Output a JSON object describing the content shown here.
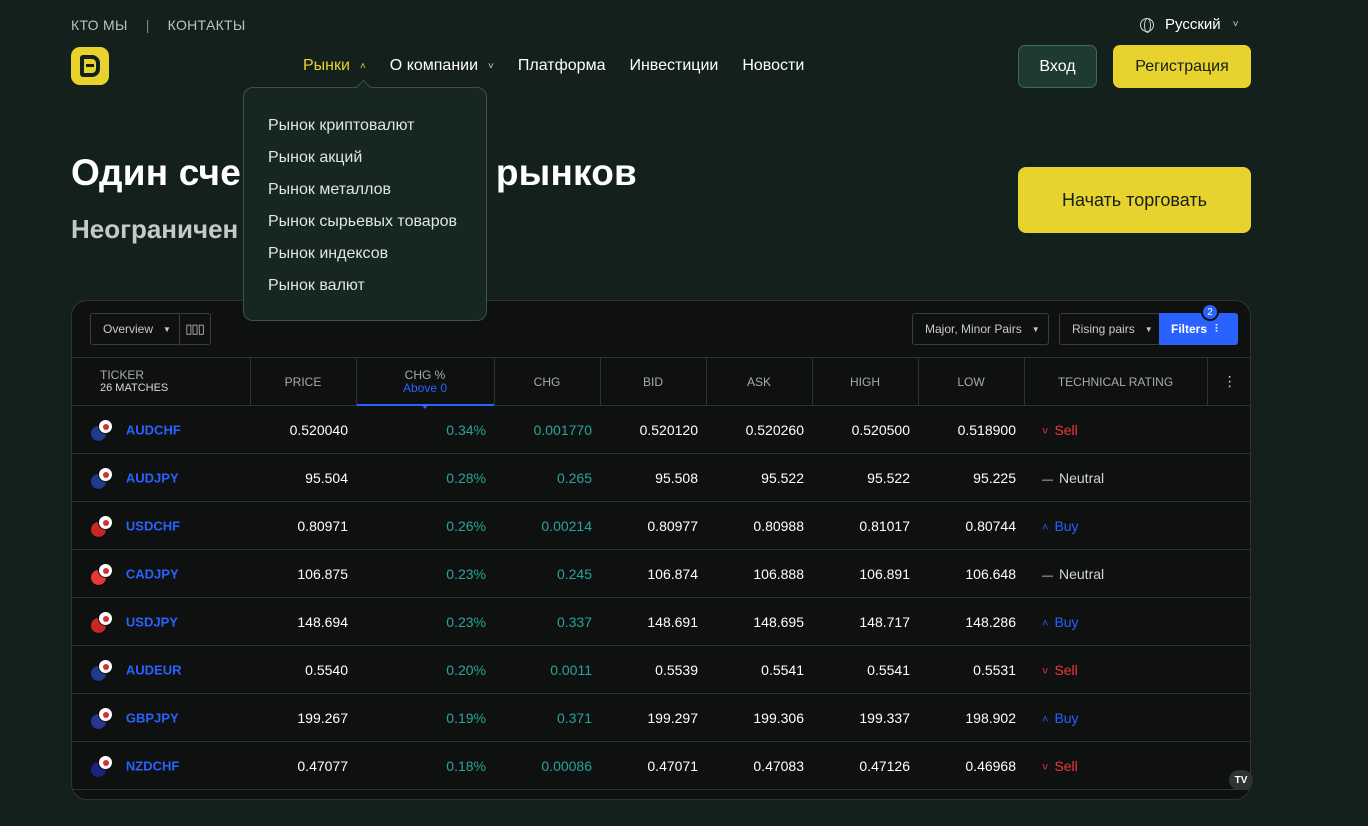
{
  "topbar": {
    "about": "КТО МЫ",
    "separator": "|",
    "contacts": "КОНТАКТЫ"
  },
  "lang": {
    "label": "Русский",
    "icon": "globe-icon"
  },
  "nav": {
    "items": [
      {
        "label": "Рынки",
        "caret": "˄",
        "active": true
      },
      {
        "label": "О компании",
        "caret": "˅"
      },
      {
        "label": "Платформа"
      },
      {
        "label": "Инвестиции"
      },
      {
        "label": "Новости"
      }
    ]
  },
  "auth": {
    "login": "Вход",
    "register": "Регистрация"
  },
  "hero": {
    "title": "Один сче                   во рынков",
    "subtitle": "Неограничен",
    "cta": "Начать торговать"
  },
  "dropdown": {
    "items": [
      "Рынок криптовалют",
      "Рынок акций",
      "Рынок металлов",
      "Рынок сырьевых товаров",
      "Рынок индексов",
      "Рынок валют"
    ]
  },
  "widget": {
    "toolbar": {
      "overview": "Overview",
      "columns_icon": "▯▯▯",
      "pairs": "Major, Minor Pairs",
      "rising": "Rising pairs",
      "filters": "Filters",
      "filters_icon": "⫶",
      "filters_count": "2"
    },
    "headers": {
      "ticker": "TICKER",
      "matches": "26 MATCHES",
      "price": "PRICE",
      "chg_pct": "CHG %",
      "chg_pct_filter": "Above 0",
      "chg": "CHG",
      "bid": "BID",
      "ask": "ASK",
      "high": "HIGH",
      "low": "LOW",
      "rating": "TECHNICAL RATING",
      "more": "⋮"
    },
    "rows": [
      {
        "sym": "AUDCHF",
        "flag1": "#1e3a8a",
        "price": "0.520040",
        "chgp": "0.34%",
        "chg": "0.001770",
        "bid": "0.520120",
        "ask": "0.520260",
        "high": "0.520500",
        "low": "0.518900",
        "rating": "Sell",
        "ricon": "˅"
      },
      {
        "sym": "AUDJPY",
        "flag1": "#1e3a8a",
        "price": "95.504",
        "chgp": "0.28%",
        "chg": "0.265",
        "bid": "95.508",
        "ask": "95.522",
        "high": "95.522",
        "low": "95.225",
        "rating": "Neutral",
        "ricon": "—"
      },
      {
        "sym": "USDCHF",
        "flag1": "#c62828",
        "price": "0.80971",
        "chgp": "0.26%",
        "chg": "0.00214",
        "bid": "0.80977",
        "ask": "0.80988",
        "high": "0.81017",
        "low": "0.80744",
        "rating": "Buy",
        "ricon": "˄"
      },
      {
        "sym": "CADJPY",
        "flag1": "#e53935",
        "price": "106.875",
        "chgp": "0.23%",
        "chg": "0.245",
        "bid": "106.874",
        "ask": "106.888",
        "high": "106.891",
        "low": "106.648",
        "rating": "Neutral",
        "ricon": "—"
      },
      {
        "sym": "USDJPY",
        "flag1": "#c62828",
        "price": "148.694",
        "chgp": "0.23%",
        "chg": "0.337",
        "bid": "148.691",
        "ask": "148.695",
        "high": "148.717",
        "low": "148.286",
        "rating": "Buy",
        "ricon": "˄"
      },
      {
        "sym": "AUDEUR",
        "flag1": "#1e3a8a",
        "price": "0.5540",
        "chgp": "0.20%",
        "chg": "0.0011",
        "bid": "0.5539",
        "ask": "0.5541",
        "high": "0.5541",
        "low": "0.5531",
        "rating": "Sell",
        "ricon": "˅"
      },
      {
        "sym": "GBPJPY",
        "flag1": "#283593",
        "price": "199.267",
        "chgp": "0.19%",
        "chg": "0.371",
        "bid": "199.297",
        "ask": "199.306",
        "high": "199.337",
        "low": "198.902",
        "rating": "Buy",
        "ricon": "˄"
      },
      {
        "sym": "NZDCHF",
        "flag1": "#1a237e",
        "price": "0.47077",
        "chgp": "0.18%",
        "chg": "0.00086",
        "bid": "0.47071",
        "ask": "0.47083",
        "high": "0.47126",
        "low": "0.46968",
        "rating": "Sell",
        "ricon": "˅"
      }
    ]
  },
  "tv_logo": "TV"
}
